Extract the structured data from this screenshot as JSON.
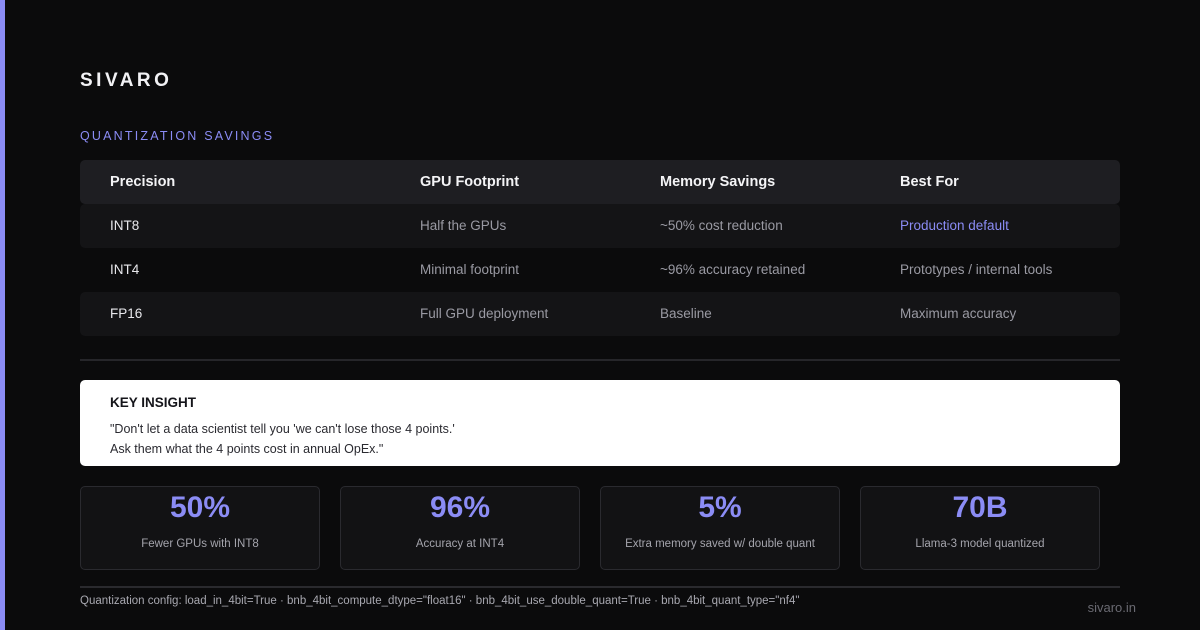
{
  "brand": "SIVARO",
  "section_title": "QUANTIZATION SAVINGS",
  "table": {
    "headers": [
      "Precision",
      "GPU Footprint",
      "Memory Savings",
      "Best For"
    ],
    "rows": [
      [
        "INT8",
        "Half the GPUs",
        "~50% cost reduction",
        "Production default"
      ],
      [
        "INT4",
        "Minimal footprint",
        "~96% accuracy retained",
        "Prototypes / internal tools"
      ],
      [
        "FP16",
        "Full GPU deployment",
        "Baseline",
        "Maximum accuracy"
      ]
    ]
  },
  "insight": {
    "title": "KEY INSIGHT",
    "line1": "\"Don't let a data scientist tell you 'we can't lose those 4 points.'",
    "line2": "Ask them what the 4 points cost in annual OpEx.\""
  },
  "stats": [
    {
      "value": "50%",
      "label": "Fewer GPUs with INT8"
    },
    {
      "value": "96%",
      "label": "Accuracy at INT4"
    },
    {
      "value": "5%",
      "label": "Extra memory saved w/ double quant"
    },
    {
      "value": "70B",
      "label": "Llama-3 model quantized"
    }
  ],
  "footer": {
    "config": "Quantization config: load_in_4bit=True · bnb_4bit_compute_dtype=\"float16\" · bnb_4bit_use_double_quant=True · bnb_4bit_quant_type=\"nf4\"",
    "site": "sivaro.in"
  },
  "colors": {
    "accent": "#8b8cf5",
    "background": "#0b0b0c",
    "insight_bg": "#ffffff"
  }
}
